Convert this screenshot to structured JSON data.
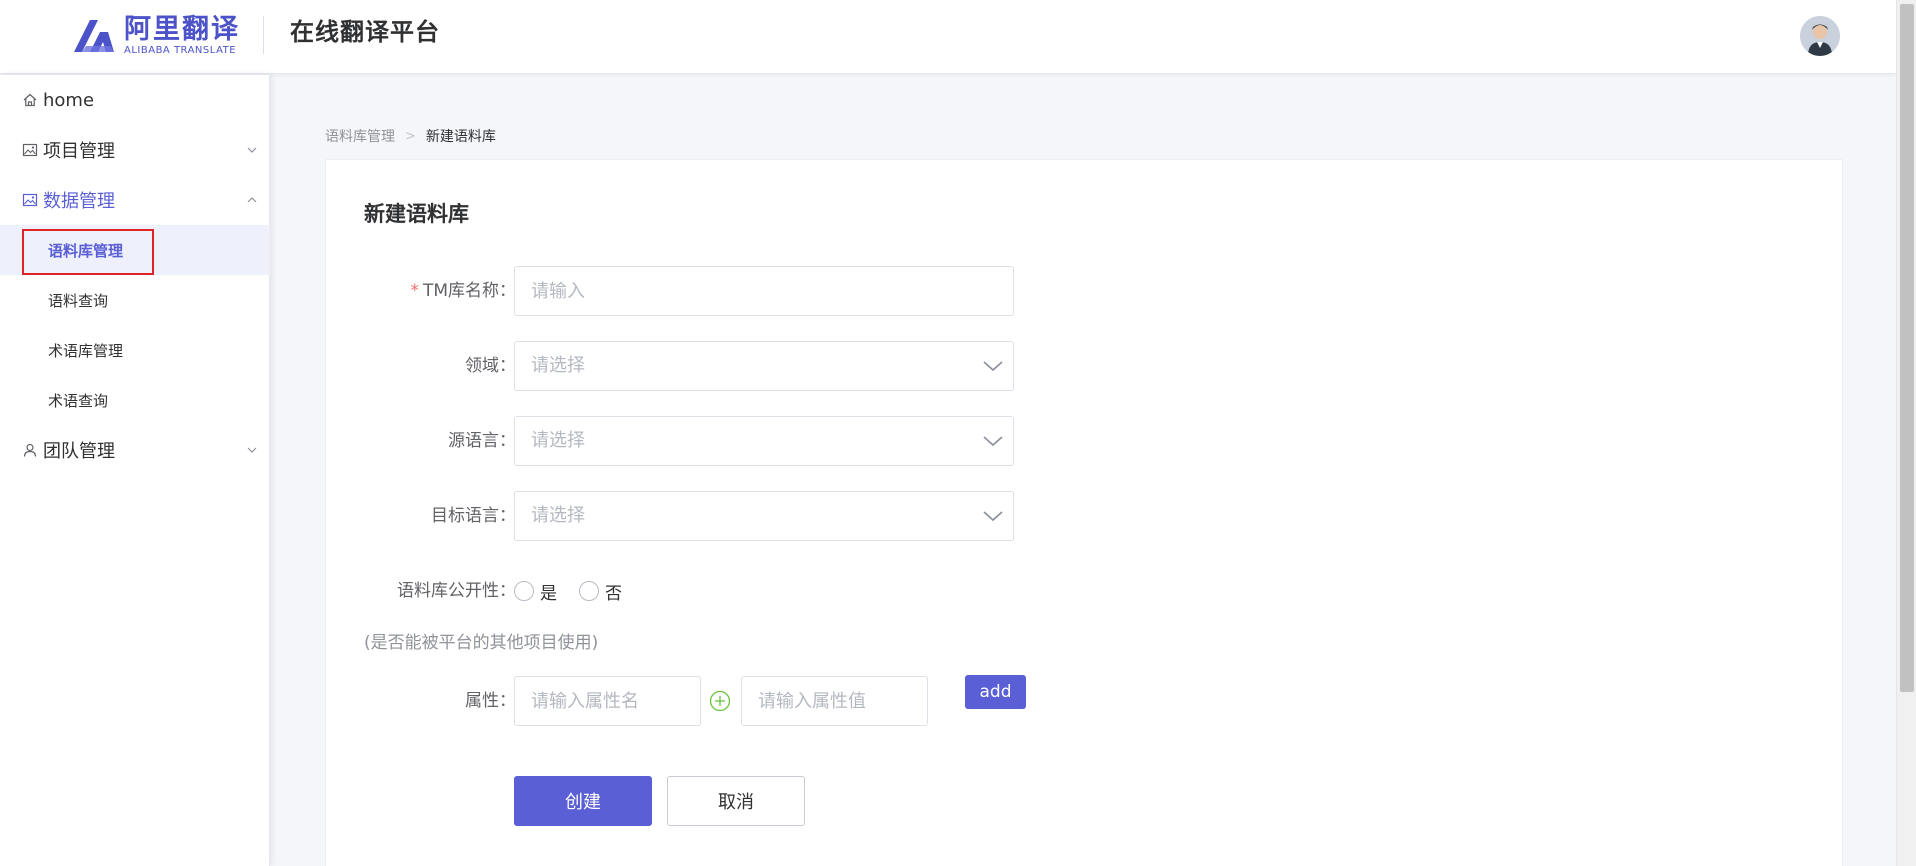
{
  "header": {
    "logo_cn": "阿里翻译",
    "logo_en": "ALIBABA TRANSLATE",
    "platform_title": "在线翻译平台"
  },
  "sidebar": {
    "items": [
      {
        "label": "home",
        "icon": "home-icon"
      },
      {
        "label": "项目管理",
        "icon": "image-icon"
      },
      {
        "label": "数据管理",
        "icon": "image-icon",
        "expanded": true,
        "children": [
          {
            "label": "语料库管理",
            "selected": true
          },
          {
            "label": "语料查询"
          },
          {
            "label": "术语库管理"
          },
          {
            "label": "术语查询"
          }
        ]
      },
      {
        "label": "团队管理",
        "icon": "user-icon"
      }
    ]
  },
  "breadcrumb": {
    "parent": "语料库管理",
    "separator": ">",
    "current": "新建语料库"
  },
  "form": {
    "title": "新建语料库",
    "tm_name": {
      "label": "TM库名称：",
      "required_mark": "*",
      "placeholder": "请输入"
    },
    "domain": {
      "label": "领域：",
      "placeholder": "请选择"
    },
    "source_lang": {
      "label": "源语言：",
      "placeholder": "请选择"
    },
    "target_lang": {
      "label": "目标语言：",
      "placeholder": "请选择"
    },
    "public": {
      "label": "语料库公开性：",
      "option_yes": "是",
      "option_no": "否"
    },
    "hint": "(是否能被平台的其他项目使用)",
    "attribute": {
      "label": "属性：",
      "name_placeholder": "请输入属性名",
      "value_placeholder": "请输入属性值",
      "add_label": "add"
    },
    "create_label": "创建",
    "cancel_label": "取消"
  },
  "colors": {
    "accent": "#5a5fd6",
    "required": "#f56c6c",
    "highlight": "#e02424",
    "plus_icon": "#67c23a"
  }
}
